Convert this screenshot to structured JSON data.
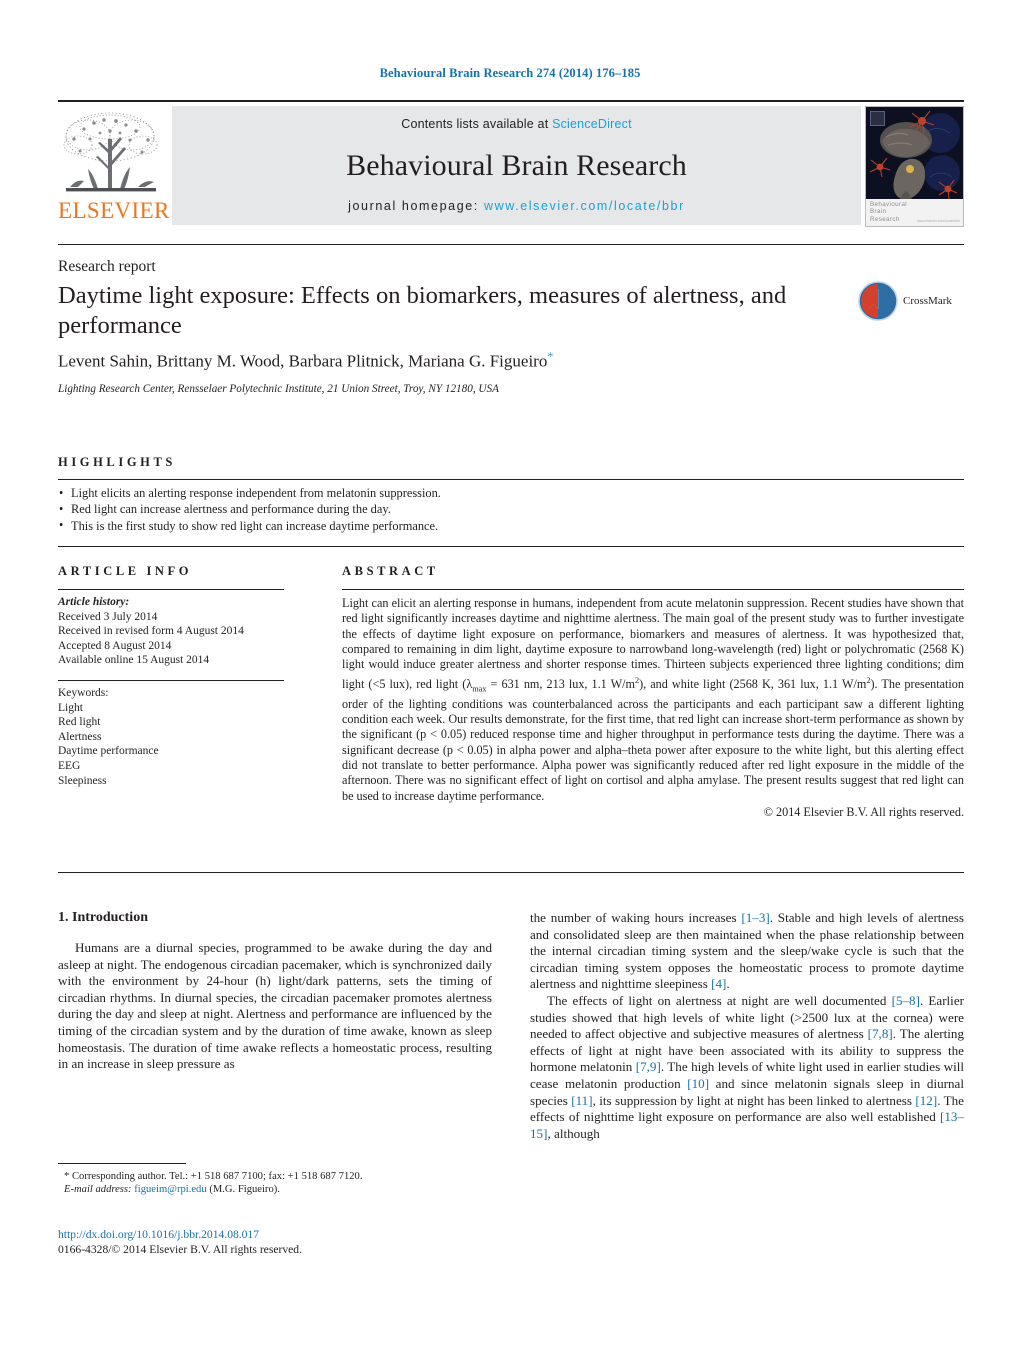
{
  "running_head": "Behavioural Brain Research 274 (2014) 176–185",
  "masthead": {
    "contents_prefix": "Contents lists available at",
    "sciencedirect": "ScienceDirect",
    "journal_name": "Behavioural Brain Research",
    "homepage_prefix": "journal homepage:",
    "homepage_url": "www.elsevier.com/locate/bbr",
    "publisher_wordmark": "ELSEVIER",
    "cover_title": "Behavioural\nBrain\nResearch",
    "cover_publisher": "www.elsevier.com/locate/bbr"
  },
  "article": {
    "type_label": "Research report",
    "title": "Daytime light exposure: Effects on biomarkers, measures of alertness, and performance",
    "authors": "Levent Sahin, Brittany M. Wood, Barbara Plitnick, Mariana G. Figueiro",
    "affiliation": "Lighting Research Center, Rensselaer Polytechnic Institute, 21 Union Street, Troy, NY 12180, USA",
    "crossmark_label": "CrossMark"
  },
  "highlights": {
    "heading": "HIGHLIGHTS",
    "items": [
      "Light elicits an alerting response independent from melatonin suppression.",
      "Red light can increase alertness and performance during the day.",
      "This is the first study to show red light can increase daytime performance."
    ]
  },
  "article_info": {
    "heading": "ARTICLE INFO",
    "history_label": "Article history:",
    "history": [
      "Received 3 July 2014",
      "Received in revised form 4 August 2014",
      "Accepted 8 August 2014",
      "Available online 15 August 2014"
    ],
    "keywords_label": "Keywords:",
    "keywords": [
      "Light",
      "Red light",
      "Alertness",
      "Daytime performance",
      "EEG",
      "Sleepiness"
    ]
  },
  "abstract": {
    "heading": "ABSTRACT",
    "text_part1": "Light can elicit an alerting response in humans, independent from acute melatonin suppression. Recent studies have shown that red light significantly increases daytime and nighttime alertness. The main goal of the present study was to further investigate the effects of daytime light exposure on performance, biomarkers and measures of alertness. It was hypothesized that, compared to remaining in dim light, daytime exposure to narrowband long-wavelength (red) light or polychromatic (2568 K) light would induce greater alertness and shorter response times. Thirteen subjects experienced three lighting conditions; dim light (<5 lux), red light (",
    "lambda_symbol": "λ",
    "lambda_sub": "max",
    "text_part2": " = 631 nm, 213 lux, 1.1 W/m",
    "sup2": "2",
    "text_part3": "), and white light (2568 K, 361 lux, 1.1 W/m",
    "text_part4": "). The presentation order of the lighting conditions was counterbalanced across the participants and each participant saw a different lighting condition each week. Our results demonstrate, for the first time, that red light can increase short-term performance as shown by the significant (p < 0.05) reduced response time and higher throughput in performance tests during the daytime. There was a significant decrease (p < 0.05) in alpha power and alpha–theta power after exposure to the white light, but this alerting effect did not translate to better performance. Alpha power was significantly reduced after red light exposure in the middle of the afternoon. There was no significant effect of light on cortisol and alpha amylase. The present results suggest that red light can be used to increase daytime performance.",
    "copyright": "© 2014 Elsevier B.V. All rights reserved."
  },
  "body": {
    "section_heading": "1. Introduction",
    "left_paragraph": "Humans are a diurnal species, programmed to be awake during the day and asleep at night. The endogenous circadian pacemaker, which is synchronized daily with the environment by 24-hour (h) light/dark patterns, sets the timing of circadian rhythms. In diurnal species, the circadian pacemaker promotes alertness during the day and sleep at night. Alertness and performance are influenced by the timing of the circadian system and by the duration of time awake, known as sleep homeostasis. The duration of time awake reflects a homeostatic process, resulting in an increase in sleep pressure as",
    "right_paragraph1_a": "the number of waking hours increases ",
    "right_ref1": "[1–3]",
    "right_paragraph1_b": ". Stable and high levels of alertness and consolidated sleep are then maintained when the phase relationship between the internal circadian timing system and the sleep/wake cycle is such that the circadian timing system opposes the homeostatic process to promote daytime alertness and nighttime sleepiness ",
    "right_ref2": "[4]",
    "right_paragraph1_c": ".",
    "right_paragraph2_a": "The effects of light on alertness at night are well documented ",
    "right_ref3": "[5–8]",
    "right_paragraph2_b": ". Earlier studies showed that high levels of white light (>2500 lux at the cornea) were needed to affect objective and subjective measures of alertness ",
    "right_ref4": "[7,8]",
    "right_paragraph2_c": ". The alerting effects of light at night have been associated with its ability to suppress the hormone melatonin ",
    "right_ref5": "[7,9]",
    "right_paragraph2_d": ". The high levels of white light used in earlier studies will cease melatonin production ",
    "right_ref6": "[10]",
    "right_paragraph2_e": " and since melatonin signals sleep in diurnal species ",
    "right_ref7": "[11]",
    "right_paragraph2_f": ", its suppression by light at night has been linked to alertness ",
    "right_ref8": "[12]",
    "right_paragraph2_g": ". The effects of nighttime light exposure on performance are also well established ",
    "right_ref9": "[13–15]",
    "right_paragraph2_h": ", although"
  },
  "footer": {
    "corresponding_marker": "*",
    "corresponding_text": "Corresponding author. Tel.: +1 518 687 7100; fax: +1 518 687 7120.",
    "email_label": "E-mail address:",
    "email": "figueim@rpi.edu",
    "email_suffix": "(M.G. Figueiro).",
    "doi": "http://dx.doi.org/10.1016/j.bbr.2014.08.017",
    "issn_line": "0166-4328/© 2014 Elsevier B.V. All rights reserved."
  },
  "colors": {
    "link_blue": "#1672a8",
    "sciencedirect_blue": "#1ba0d7",
    "elsevier_orange": "#e87722",
    "masthead_gray": "#e6e7e8"
  }
}
